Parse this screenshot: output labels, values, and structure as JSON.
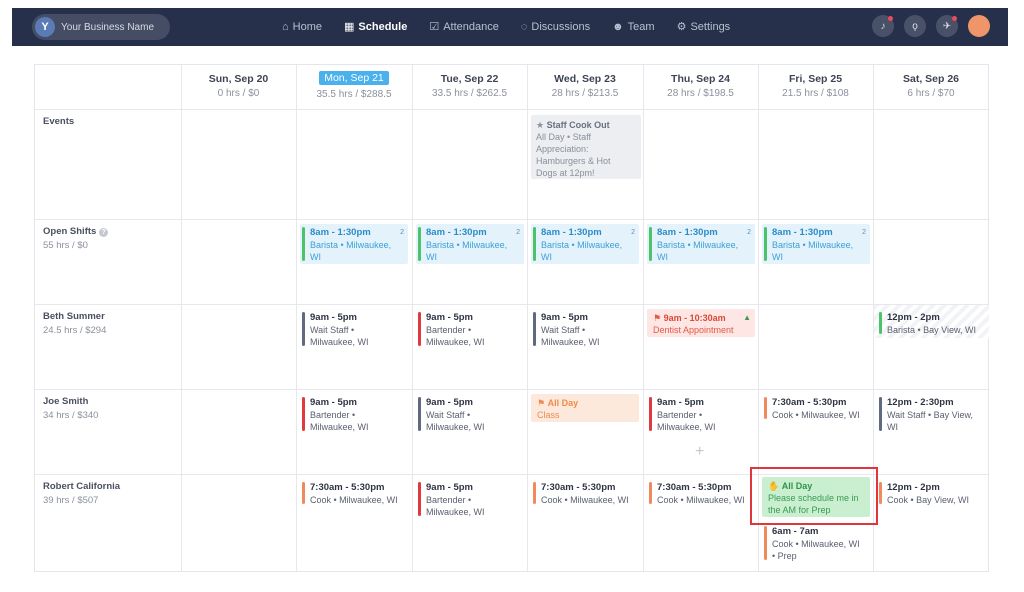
{
  "topbar": {
    "business_name": "Your Business Name",
    "logo_letter": "Y",
    "nav": [
      {
        "label": "Home",
        "icon": "home-icon",
        "active": false
      },
      {
        "label": "Schedule",
        "icon": "calendar-icon",
        "active": true
      },
      {
        "label": "Attendance",
        "icon": "clipboard-icon",
        "active": false
      },
      {
        "label": "Discussions",
        "icon": "chat-icon",
        "active": false
      },
      {
        "label": "Team",
        "icon": "team-icon",
        "active": false
      },
      {
        "label": "Settings",
        "icon": "gear-icon",
        "active": false
      }
    ]
  },
  "days": [
    {
      "name": "Sun, Sep 20",
      "hours": "0 hrs / $0"
    },
    {
      "name": "Mon, Sep 21",
      "hours": "35.5 hrs / $288.5"
    },
    {
      "name": "Tue, Sep 22",
      "hours": "33.5 hrs / $262.5"
    },
    {
      "name": "Wed, Sep 23",
      "hours": "28 hrs / $213.5"
    },
    {
      "name": "Thu, Sep 24",
      "hours": "28 hrs / $198.5"
    },
    {
      "name": "Fri, Sep 25",
      "hours": "21.5 hrs / $108"
    },
    {
      "name": "Sat, Sep 26",
      "hours": "6 hrs / $70"
    }
  ],
  "rows": {
    "events": {
      "name": "Events"
    },
    "open": {
      "name": "Open Shifts",
      "sub": "55 hrs / $0"
    },
    "beth": {
      "name": "Beth Summer",
      "sub": "24.5 hrs / $294"
    },
    "joe": {
      "name": "Joe Smith",
      "sub": "34 hrs / $340"
    },
    "robert": {
      "name": "Robert California",
      "sub": "39 hrs / $507"
    }
  },
  "event": {
    "title": "Staff Cook Out",
    "line1": "All Day • Staff",
    "line2": "Appreciation:",
    "line3": "Hamburgers & Hot",
    "line4": "Dogs at 12pm!"
  },
  "open_shift": {
    "time": "8am - 1:30pm",
    "role": "Barista • Milwaukee,",
    "loc": "WI",
    "count": "2"
  },
  "beth": {
    "mon": {
      "time": "9am - 5pm",
      "l1": "Wait Staff •",
      "l2": "Milwaukee, WI"
    },
    "tue": {
      "time": "9am - 5pm",
      "l1": "Bartender •",
      "l2": "Milwaukee, WI"
    },
    "wed": {
      "time": "9am - 5pm",
      "l1": "Wait Staff •",
      "l2": "Milwaukee, WI"
    },
    "thu": {
      "time": "9am - 10:30am",
      "l1": "Dentist Appointment"
    },
    "sat": {
      "time": "12pm - 2pm",
      "l1": "Barista • Bay View, WI"
    }
  },
  "joe": {
    "mon": {
      "time": "9am - 5pm",
      "l1": "Bartender •",
      "l2": "Milwaukee, WI"
    },
    "tue": {
      "time": "9am - 5pm",
      "l1": "Wait Staff •",
      "l2": "Milwaukee, WI"
    },
    "wed": {
      "time": "All Day",
      "l1": "Class"
    },
    "thu": {
      "time": "9am - 5pm",
      "l1": "Bartender •",
      "l2": "Milwaukee, WI"
    },
    "fri": {
      "time": "7:30am - 5:30pm",
      "l1": "Cook • Milwaukee, WI"
    },
    "sat": {
      "time": "12pm - 2:30pm",
      "l1": "Wait Staff • Bay View,",
      "l2": "WI"
    }
  },
  "robert": {
    "mon": {
      "time": "7:30am - 5:30pm",
      "l1": "Cook • Milwaukee, WI"
    },
    "tue": {
      "time": "9am - 5pm",
      "l1": "Bartender •",
      "l2": "Milwaukee, WI"
    },
    "wed": {
      "time": "7:30am - 5:30pm",
      "l1": "Cook • Milwaukee, WI"
    },
    "thu": {
      "time": "7:30am - 5:30pm",
      "l1": "Cook • Milwaukee, WI"
    },
    "fri_request": {
      "time": "All Day",
      "l1": "Please schedule me in",
      "l2": "the AM for Prep"
    },
    "fri": {
      "time": "6am - 7am",
      "l1": "Cook • Milwaukee, WI",
      "l2": "• Prep"
    },
    "sat": {
      "time": "12pm - 2pm",
      "l1": "Cook • Bay View, WI"
    }
  },
  "colors": {
    "nav_bg": "#26304a",
    "today_bg": "#4ab1ec",
    "open_shift_bar": "#4cc36a",
    "wait_staff_bar": "#5f6a80",
    "bartender_bar": "#e0393e",
    "cook_bar": "#f08a5d",
    "barista_bar": "#4cc36a",
    "highlight": "#e0353a"
  }
}
